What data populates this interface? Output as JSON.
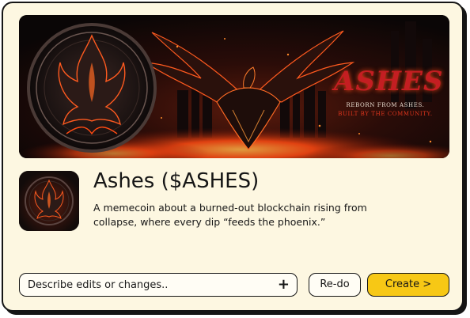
{
  "banner": {
    "title": "ASHES",
    "tagline_1": "REBORN FROM ASHES.",
    "tagline_2": "BUILT BY THE COMMUNITY."
  },
  "token": {
    "name": "Ashes ($ASHES)",
    "description": "A memecoin about a burned-out blockchain rising from collapse, where every dip “feeds the phoenix.”"
  },
  "edit_input": {
    "placeholder": "Describe edits or changes..",
    "value": "",
    "action_icon": "plus-icon"
  },
  "buttons": {
    "redo_label": "Re-do",
    "create_label": "Create >"
  },
  "colors": {
    "card_background": "#fdf7e1",
    "create_button": "#f7c815",
    "brand_red": "#c41e22",
    "ember_orange": "#ff5a1f"
  },
  "icons": {
    "banner_emblem": "phoenix-medallion-icon",
    "banner_art": "phoenix-bird-icon",
    "token_logo": "phoenix-logo-icon"
  }
}
